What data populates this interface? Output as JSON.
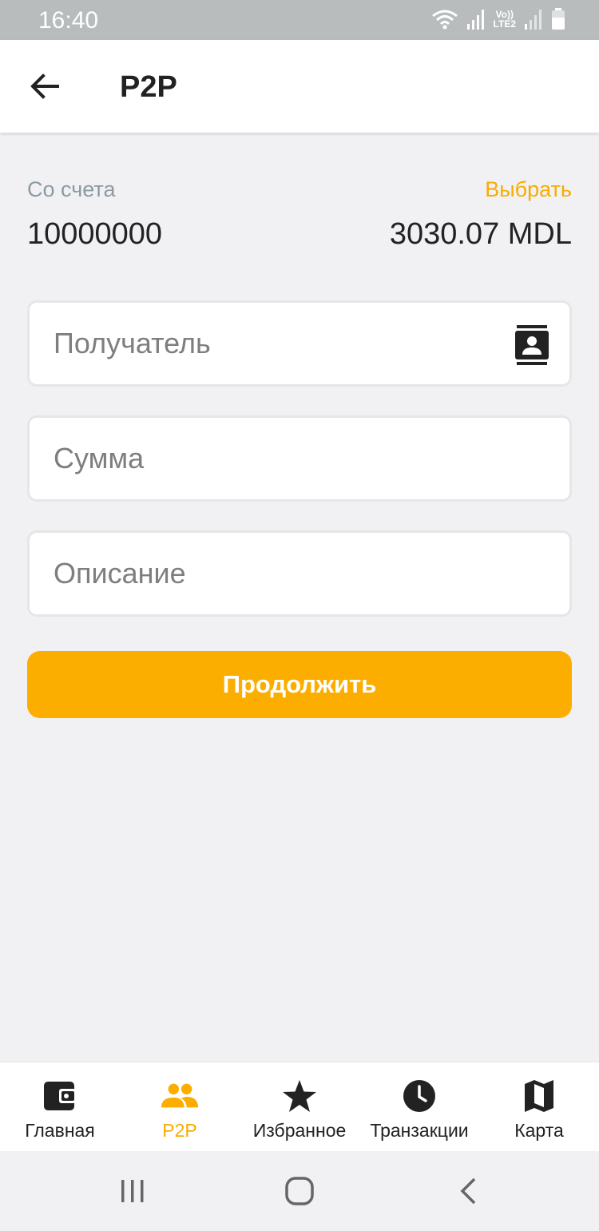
{
  "status_bar": {
    "time": "16:40",
    "network_top": "Vo))",
    "network_bottom": "LTE2",
    "icons": [
      "wifi-icon",
      "signal-icon",
      "signal-icon",
      "battery-icon"
    ]
  },
  "app_bar": {
    "back_icon": "arrow-left-icon",
    "title": "P2P"
  },
  "account": {
    "label": "Со счета",
    "choose_label": "Выбрать",
    "number": "10000000",
    "balance": "3030.07 MDL"
  },
  "form": {
    "recipient": {
      "value": "",
      "placeholder": "Получатель",
      "icon": "contacts-icon"
    },
    "amount": {
      "value": "",
      "placeholder": "Сумма"
    },
    "description": {
      "value": "",
      "placeholder": "Описание"
    },
    "submit_label": "Продолжить"
  },
  "bottom_nav": {
    "items": [
      {
        "label": "Главная",
        "icon": "wallet-icon",
        "active": false
      },
      {
        "label": "P2P",
        "icon": "people-icon",
        "active": true
      },
      {
        "label": "Избранное",
        "icon": "star-icon",
        "active": false
      },
      {
        "label": "Транзакции",
        "icon": "clock-icon",
        "active": false
      },
      {
        "label": "Карта",
        "icon": "map-icon",
        "active": false
      }
    ]
  },
  "system_nav": {
    "icons": [
      "recent-apps-icon",
      "home-icon",
      "back-icon"
    ]
  },
  "colors": {
    "accent": "#fcae00",
    "accent_text": "#f8ac00",
    "background": "#f1f1f3",
    "status_bar": "#b9bcbd",
    "muted_text": "#8c9aa3"
  }
}
